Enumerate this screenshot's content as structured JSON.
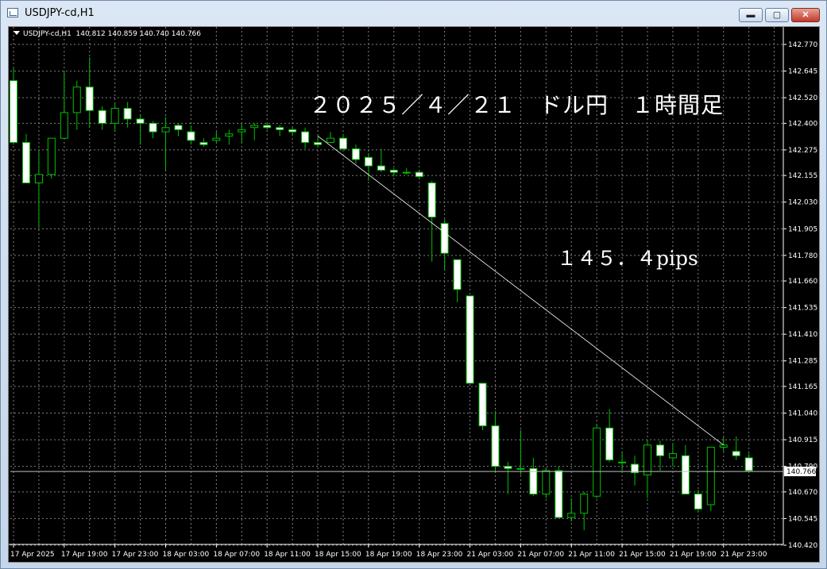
{
  "window": {
    "title": "USDJPY-cd,H1",
    "buttons": {
      "minimize": "▬",
      "maximize": "▢",
      "close": "✕"
    }
  },
  "chart_header": {
    "symbol": "USDJPY-cd,H1",
    "ohlc": "140.812 140.859 140.740 140.766"
  },
  "annotations": {
    "title": "２０２５／４／２１　ドル円　１時間足",
    "pips": "１４５．４pips"
  },
  "colors": {
    "background": "#000000",
    "grid": "#808080",
    "candle": "#00c000",
    "bull_body": "#000000",
    "bear_body": "#ffffff",
    "trendline": "#ffffff",
    "text": "#ffffff"
  },
  "chart_data": {
    "type": "candlestick",
    "timeframe": "H1",
    "price_ticks": [
      "142.770",
      "142.645",
      "142.520",
      "142.400",
      "142.275",
      "142.155",
      "142.030",
      "141.905",
      "141.780",
      "141.660",
      "141.535",
      "141.410",
      "141.285",
      "141.165",
      "141.040",
      "140.915",
      "140.790",
      "140.670",
      "140.545",
      "140.420"
    ],
    "current_price": "140.766",
    "time_labels": [
      "17 Apr 2025",
      "17 Apr 19:00",
      "17 Apr 23:00",
      "18 Apr 03:00",
      "18 Apr 07:00",
      "18 Apr 11:00",
      "18 Apr 15:00",
      "18 Apr 19:00",
      "18 Apr 23:00",
      "21 Apr 03:00",
      "21 Apr 07:00",
      "21 Apr 11:00",
      "21 Apr 15:00",
      "21 Apr 19:00",
      "21 Apr 23:00"
    ],
    "candles": [
      {
        "o": 142.6,
        "h": 142.66,
        "l": 142.3,
        "c": 142.31
      },
      {
        "o": 142.31,
        "h": 142.35,
        "l": 142.12,
        "c": 142.12
      },
      {
        "o": 142.12,
        "h": 142.27,
        "l": 141.91,
        "c": 142.16
      },
      {
        "o": 142.16,
        "h": 142.33,
        "l": 142.14,
        "c": 142.33
      },
      {
        "o": 142.33,
        "h": 142.64,
        "l": 142.33,
        "c": 142.45
      },
      {
        "o": 142.45,
        "h": 142.6,
        "l": 142.37,
        "c": 142.57
      },
      {
        "o": 142.57,
        "h": 142.71,
        "l": 142.38,
        "c": 142.46
      },
      {
        "o": 142.46,
        "h": 142.48,
        "l": 142.37,
        "c": 142.4
      },
      {
        "o": 142.4,
        "h": 142.49,
        "l": 142.36,
        "c": 142.47
      },
      {
        "o": 142.47,
        "h": 142.5,
        "l": 142.38,
        "c": 142.42
      },
      {
        "o": 142.42,
        "h": 142.44,
        "l": 142.3,
        "c": 142.4
      },
      {
        "o": 142.4,
        "h": 142.41,
        "l": 142.33,
        "c": 142.36
      },
      {
        "o": 142.36,
        "h": 142.43,
        "l": 142.18,
        "c": 142.38
      },
      {
        "o": 142.39,
        "h": 142.4,
        "l": 142.34,
        "c": 142.37
      },
      {
        "o": 142.36,
        "h": 142.39,
        "l": 142.3,
        "c": 142.32
      },
      {
        "o": 142.31,
        "h": 142.33,
        "l": 142.29,
        "c": 142.3
      },
      {
        "o": 142.32,
        "h": 142.36,
        "l": 142.31,
        "c": 142.33
      },
      {
        "o": 142.34,
        "h": 142.37,
        "l": 142.3,
        "c": 142.35
      },
      {
        "o": 142.36,
        "h": 142.4,
        "l": 142.31,
        "c": 142.37
      },
      {
        "o": 142.38,
        "h": 142.4,
        "l": 142.32,
        "c": 142.39
      },
      {
        "o": 142.39,
        "h": 142.4,
        "l": 142.37,
        "c": 142.38
      },
      {
        "o": 142.38,
        "h": 142.39,
        "l": 142.34,
        "c": 142.37
      },
      {
        "o": 142.37,
        "h": 142.38,
        "l": 142.34,
        "c": 142.36
      },
      {
        "o": 142.36,
        "h": 142.38,
        "l": 142.28,
        "c": 142.31
      },
      {
        "o": 142.31,
        "h": 142.34,
        "l": 142.29,
        "c": 142.3
      },
      {
        "o": 142.31,
        "h": 142.36,
        "l": 142.31,
        "c": 142.33
      },
      {
        "o": 142.33,
        "h": 142.35,
        "l": 142.27,
        "c": 142.28
      },
      {
        "o": 142.28,
        "h": 142.3,
        "l": 142.21,
        "c": 142.23
      },
      {
        "o": 142.24,
        "h": 142.26,
        "l": 142.13,
        "c": 142.2
      },
      {
        "o": 142.2,
        "h": 142.28,
        "l": 142.17,
        "c": 142.18
      },
      {
        "o": 142.18,
        "h": 142.19,
        "l": 142.15,
        "c": 142.17
      },
      {
        "o": 142.17,
        "h": 142.19,
        "l": 142.16,
        "c": 142.17
      },
      {
        "o": 142.17,
        "h": 142.18,
        "l": 142.14,
        "c": 142.15
      },
      {
        "o": 142.12,
        "h": 142.13,
        "l": 141.75,
        "c": 141.96
      },
      {
        "o": 141.93,
        "h": 141.95,
        "l": 141.71,
        "c": 141.79
      },
      {
        "o": 141.76,
        "h": 141.76,
        "l": 141.56,
        "c": 141.62
      },
      {
        "o": 141.59,
        "h": 141.59,
        "l": 141.18,
        "c": 141.18
      },
      {
        "o": 141.18,
        "h": 141.18,
        "l": 140.96,
        "c": 140.98
      },
      {
        "o": 140.98,
        "h": 141.05,
        "l": 140.76,
        "c": 140.79
      },
      {
        "o": 140.79,
        "h": 140.81,
        "l": 140.66,
        "c": 140.78
      },
      {
        "o": 140.78,
        "h": 140.96,
        "l": 140.75,
        "c": 140.78
      },
      {
        "o": 140.78,
        "h": 140.83,
        "l": 140.65,
        "c": 140.66
      },
      {
        "o": 140.66,
        "h": 140.78,
        "l": 140.64,
        "c": 140.77
      },
      {
        "o": 140.77,
        "h": 140.79,
        "l": 140.55,
        "c": 140.55
      },
      {
        "o": 140.55,
        "h": 140.64,
        "l": 140.53,
        "c": 140.57
      },
      {
        "o": 140.57,
        "h": 140.67,
        "l": 140.49,
        "c": 140.66
      },
      {
        "o": 140.65,
        "h": 140.99,
        "l": 140.64,
        "c": 140.97
      },
      {
        "o": 140.97,
        "h": 141.06,
        "l": 140.81,
        "c": 140.82
      },
      {
        "o": 140.81,
        "h": 140.86,
        "l": 140.77,
        "c": 140.81
      },
      {
        "o": 140.8,
        "h": 140.84,
        "l": 140.7,
        "c": 140.76
      },
      {
        "o": 140.75,
        "h": 140.91,
        "l": 140.64,
        "c": 140.89
      },
      {
        "o": 140.89,
        "h": 140.91,
        "l": 140.77,
        "c": 140.84
      },
      {
        "o": 140.83,
        "h": 140.9,
        "l": 140.79,
        "c": 140.85
      },
      {
        "o": 140.84,
        "h": 140.89,
        "l": 140.68,
        "c": 140.66
      },
      {
        "o": 140.66,
        "h": 140.68,
        "l": 140.58,
        "c": 140.59
      },
      {
        "o": 140.61,
        "h": 140.88,
        "l": 140.58,
        "c": 140.88
      },
      {
        "o": 140.88,
        "h": 140.93,
        "l": 140.86,
        "c": 140.89
      },
      {
        "o": 140.86,
        "h": 140.93,
        "l": 140.82,
        "c": 140.84
      },
      {
        "o": 140.83,
        "h": 140.85,
        "l": 140.77,
        "c": 140.77
      }
    ],
    "trendline": {
      "from_price": 142.34,
      "to_price": 140.89
    }
  }
}
